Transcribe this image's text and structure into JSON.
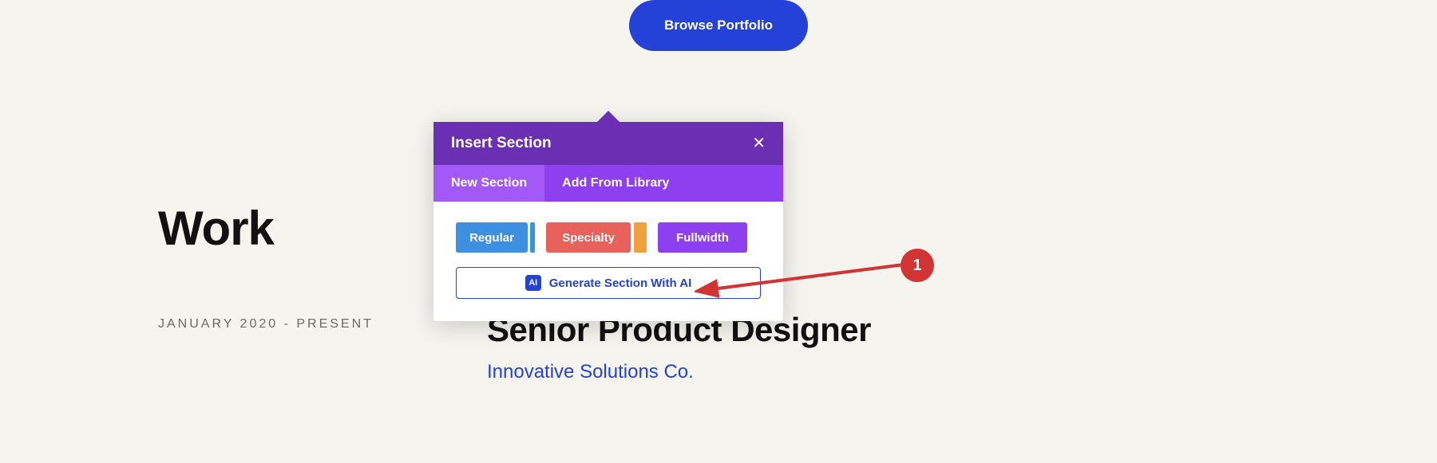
{
  "hero": {
    "portfolio_button": "Browse Portfolio"
  },
  "work": {
    "heading": "Work",
    "date_range": "JANUARY 2020 - PRESENT",
    "job_title": "Senior Product Designer",
    "company": "Innovative Solutions Co."
  },
  "panel": {
    "title": "Insert Section",
    "tabs": {
      "new": "New Section",
      "library": "Add From Library"
    },
    "types": {
      "regular": "Regular",
      "specialty": "Specialty",
      "fullwidth": "Fullwidth"
    },
    "ai_label": "Generate Section With AI",
    "ai_icon_text": "AI"
  },
  "annotation": {
    "number": "1"
  }
}
